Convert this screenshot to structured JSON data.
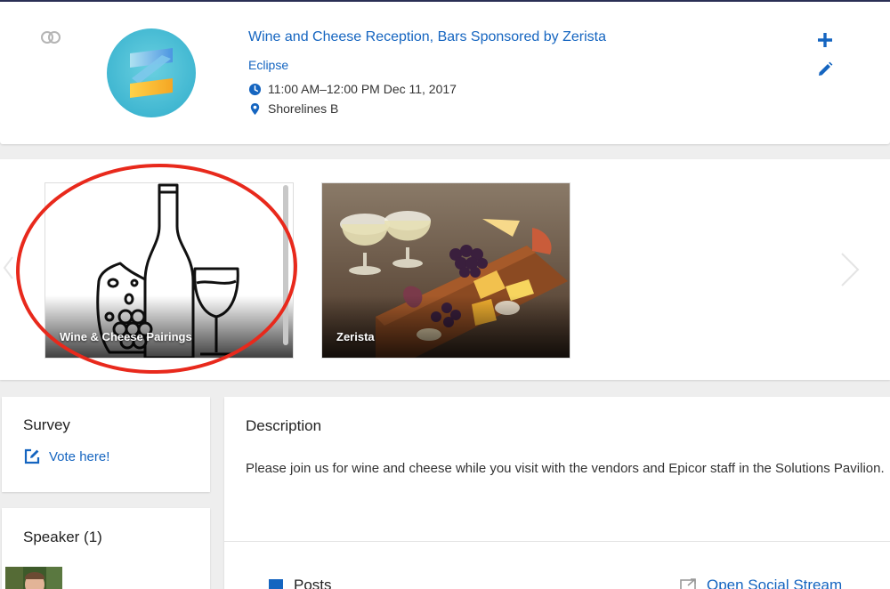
{
  "event": {
    "title": "Wine and Cheese Reception, Bars Sponsored by Zerista",
    "track": "Eclipse",
    "time": "11:00 AM–12:00 PM Dec 11, 2017",
    "location": "Shorelines B"
  },
  "carousel": {
    "items": [
      {
        "label": "Wine & Cheese Pairings"
      },
      {
        "label": "Zerista"
      }
    ]
  },
  "survey": {
    "heading": "Survey",
    "link_label": "Vote here!"
  },
  "speaker": {
    "heading": "Speaker (1)"
  },
  "description": {
    "heading": "Description",
    "text": "Please join us for wine and cheese while you visit with the vendors and Epicor staff in the Solutions Pavilion."
  },
  "social": {
    "posts_label": "Posts",
    "stream_label": "Open Social Stream"
  },
  "colors": {
    "link": "#1565c0",
    "annotation": "#e8291c",
    "background": "#eeeeee"
  },
  "icons": [
    "rings-icon",
    "plus-icon",
    "pencil-icon",
    "clock-icon",
    "location-pin-icon",
    "edit-square-icon",
    "chat-bubble-icon",
    "external-link-icon",
    "chevron-left-icon",
    "chevron-right-icon"
  ]
}
